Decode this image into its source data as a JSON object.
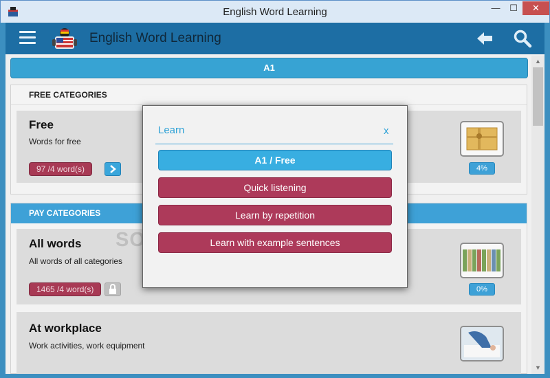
{
  "window": {
    "title": "English Word Learning",
    "minimize": "—",
    "maximize": "☐",
    "close": "✕"
  },
  "appbar": {
    "title": "English Word Learning"
  },
  "level": {
    "label": "A1"
  },
  "free_section": {
    "header": "FREE CATEGORIES",
    "card": {
      "title": "Free",
      "subtitle": "Words for free",
      "count": "97 /4 word(s)",
      "percent": "4%"
    }
  },
  "pay_section": {
    "header": "PAY CATEGORIES",
    "cards": [
      {
        "title": "All words",
        "subtitle": "All words of all categories",
        "count": "1465 /4 word(s)",
        "percent": "0%"
      },
      {
        "title": "At workplace",
        "subtitle": "Work activities, work equipment"
      }
    ]
  },
  "dialog": {
    "title": "Learn",
    "close": "x",
    "options": [
      "A1 / Free",
      "Quick listening",
      "Learn by repetition",
      "Learn with example sentences"
    ]
  },
  "watermark": "SOFTPEDIA",
  "colors": {
    "accent": "#3ea1d7",
    "header": "#1d6ea4",
    "pill": "#a83a55"
  }
}
